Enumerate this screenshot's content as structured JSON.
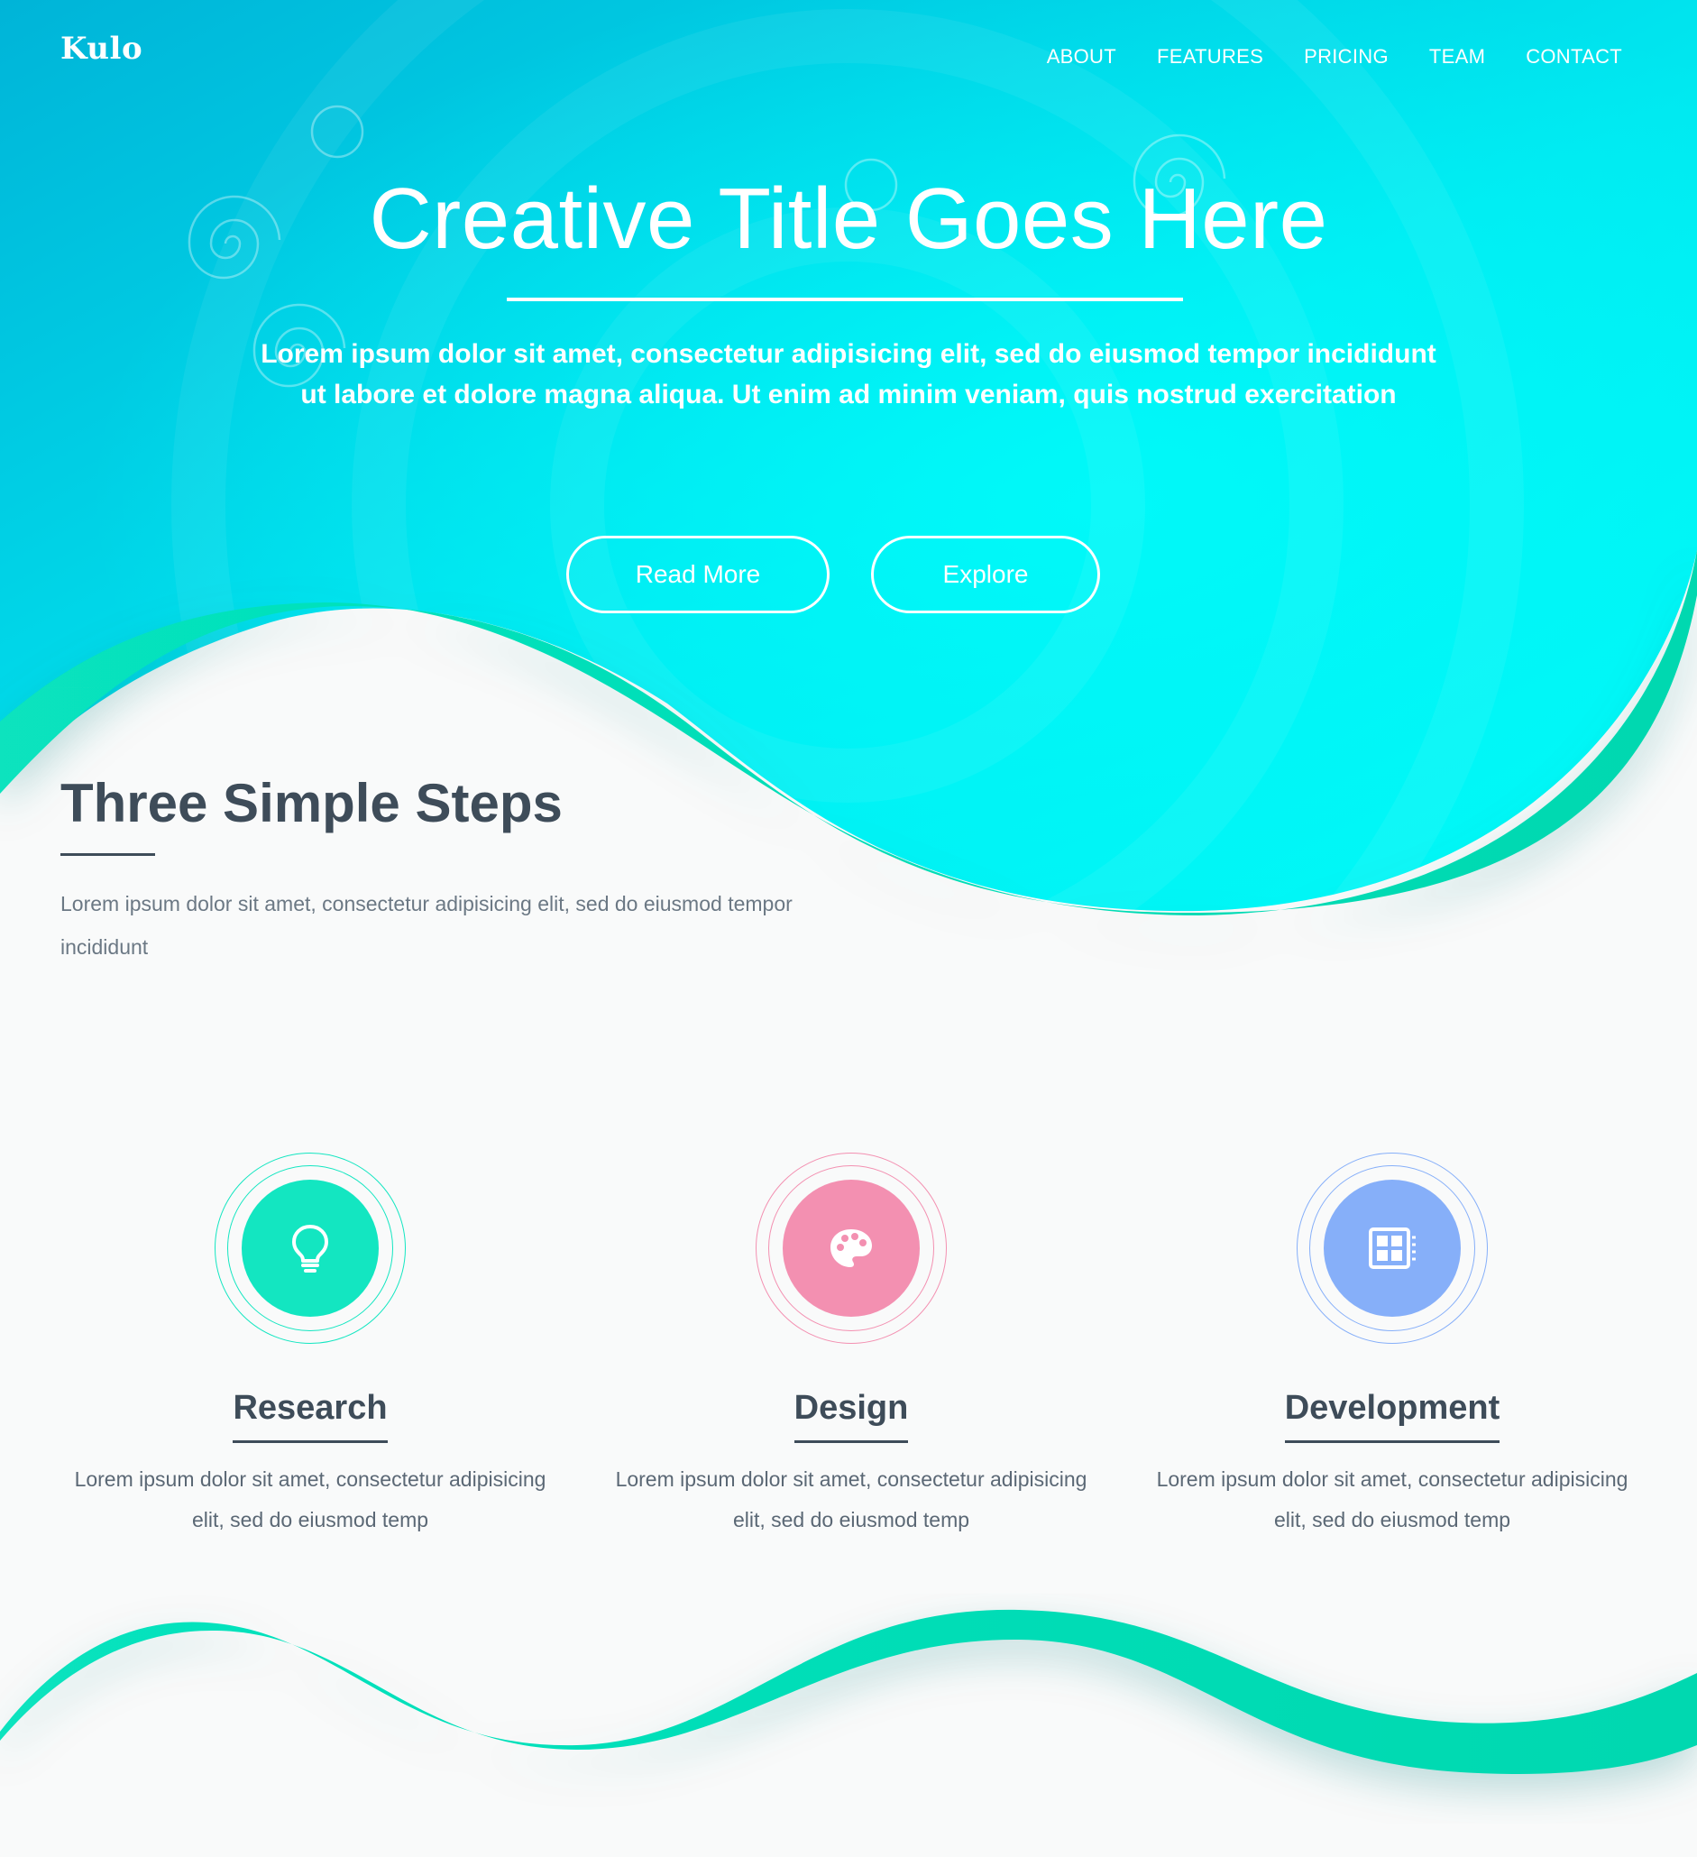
{
  "brand": {
    "logo": "Kulo"
  },
  "nav": {
    "items": [
      "ABOUT",
      "FEATURES",
      "PRICING",
      "TEAM",
      "CONTACT"
    ]
  },
  "hero": {
    "title": "Creative Title Goes Here",
    "subtitle": "Lorem ipsum dolor sit amet, consectetur adipisicing elit, sed do eiusmod tempor incididunt ut labore et dolore magna aliqua. Ut enim ad minim veniam, quis nostrud exercitation",
    "buttons": {
      "read_more": "Read More",
      "explore": "Explore"
    }
  },
  "steps_section": {
    "title": "Three Simple Steps",
    "subtitle": "Lorem ipsum dolor sit amet, consectetur adipisicing elit, sed do eiusmod tempor incididunt"
  },
  "steps": [
    {
      "title": "Research",
      "text": "Lorem ipsum dolor sit amet, consectetur adipisicing elit, sed do eiusmod temp",
      "icon": "lightbulb-icon",
      "color": "#13e6c1"
    },
    {
      "title": "Design",
      "text": "Lorem ipsum dolor sit amet, consectetur adipisicing elit, sed do eiusmod temp",
      "icon": "palette-icon",
      "color": "#f390b1"
    },
    {
      "title": "Development",
      "text": "Lorem ipsum dolor sit amet, consectetur adipisicing elit, sed do eiusmod temp",
      "icon": "layout-icon",
      "color": "#86aff9"
    }
  ],
  "colors": {
    "hero_gradient_start": "#00b4d8",
    "hero_gradient_end": "#00f6f8",
    "wave_green": "#03dcb3",
    "text_dark": "#3e4c59",
    "page_bg": "#f9fafa"
  }
}
